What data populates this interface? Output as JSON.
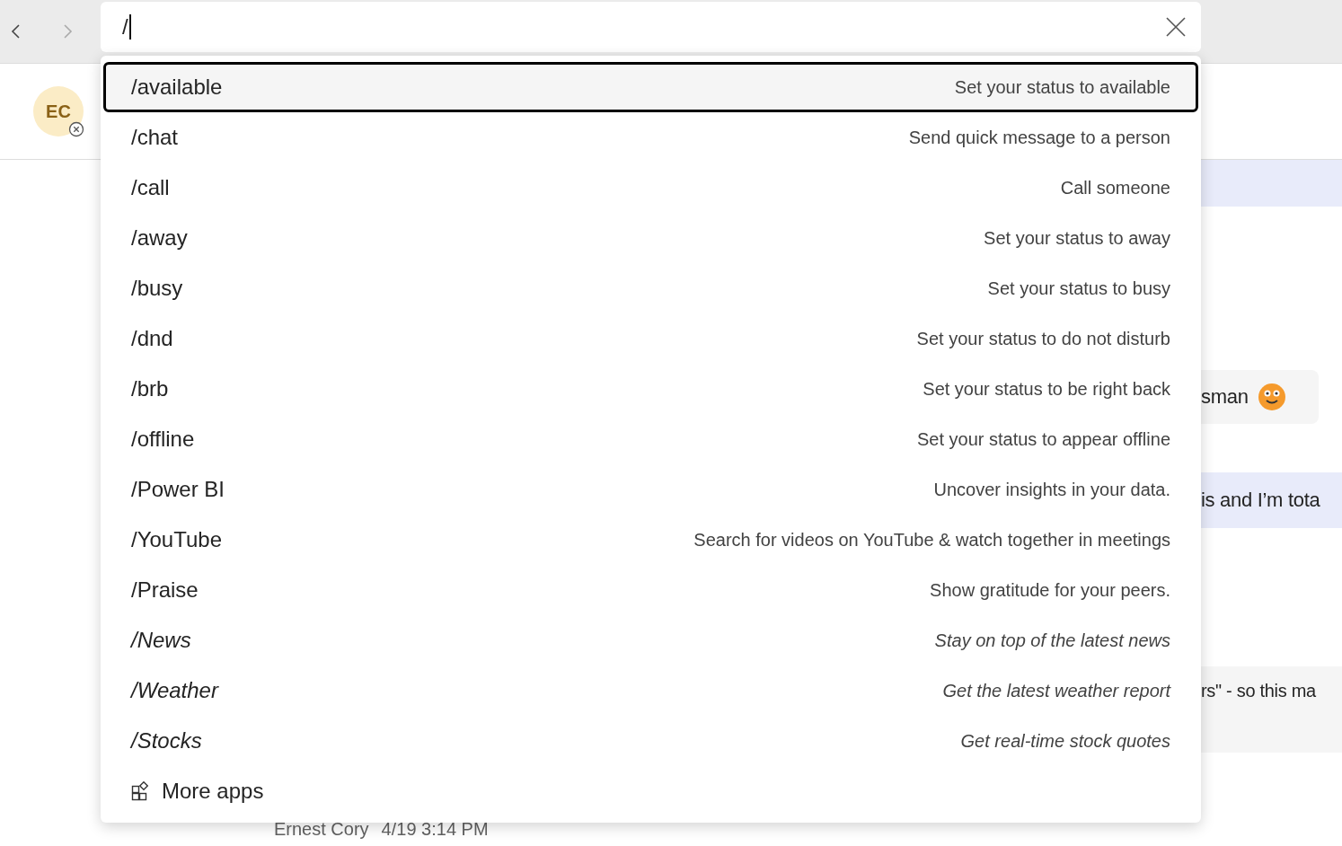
{
  "search": {
    "value": "/"
  },
  "header": {
    "avatar_initials": "EC"
  },
  "chat": {
    "bubbles": [
      {
        "text": "sman",
        "kind": "emoji"
      },
      {
        "text": "is and I’m tota",
        "kind": "mine"
      },
      {
        "text": "rs\" - so this ma",
        "kind": "other"
      }
    ],
    "meta": {
      "author": "Ernest Cory",
      "time": "4/19 3:14 PM"
    }
  },
  "commands": [
    {
      "command": "/available",
      "description": "Set your status to available",
      "selected": true,
      "italic": false
    },
    {
      "command": "/chat",
      "description": "Send quick message to a person",
      "selected": false,
      "italic": false
    },
    {
      "command": "/call",
      "description": "Call someone",
      "selected": false,
      "italic": false
    },
    {
      "command": "/away",
      "description": "Set your status to away",
      "selected": false,
      "italic": false
    },
    {
      "command": "/busy",
      "description": "Set your status to busy",
      "selected": false,
      "italic": false
    },
    {
      "command": "/dnd",
      "description": "Set your status to do not disturb",
      "selected": false,
      "italic": false
    },
    {
      "command": "/brb",
      "description": "Set your status to be right back",
      "selected": false,
      "italic": false
    },
    {
      "command": "/offline",
      "description": "Set your status to appear offline",
      "selected": false,
      "italic": false
    },
    {
      "command": "/Power BI",
      "description": "Uncover insights in your data.",
      "selected": false,
      "italic": false
    },
    {
      "command": "/YouTube",
      "description": "Search for videos on YouTube & watch together in meetings",
      "selected": false,
      "italic": false
    },
    {
      "command": "/Praise",
      "description": "Show gratitude for your peers.",
      "selected": false,
      "italic": false
    },
    {
      "command": "/News",
      "description": "Stay on top of the latest news",
      "selected": false,
      "italic": true
    },
    {
      "command": "/Weather",
      "description": "Get the latest weather report",
      "selected": false,
      "italic": true
    },
    {
      "command": "/Stocks",
      "description": "Get real-time stock quotes",
      "selected": false,
      "italic": true
    }
  ],
  "more_apps": {
    "label": "More apps"
  }
}
